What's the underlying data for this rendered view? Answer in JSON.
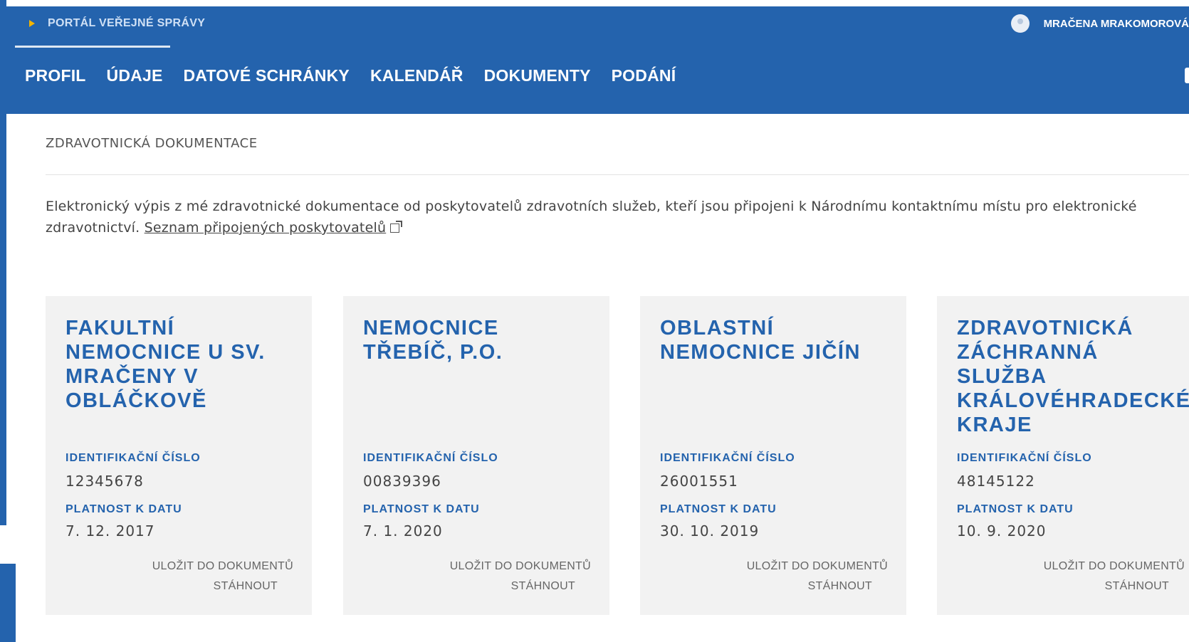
{
  "header": {
    "portal_label": "PORTÁL VEŘEJNÉ SPRÁVY",
    "user_name": "MRAČENA MRAKOMOROVÁ",
    "nav": [
      "PROFIL",
      "ÚDAJE",
      "DATOVÉ SCHRÁNKY",
      "KALENDÁŘ",
      "DOKUMENTY",
      "PODÁNÍ"
    ]
  },
  "page": {
    "breadcrumb": "ZDRAVOTNICKÁ DOKUMENTACE",
    "intro_text": "Elektronický výpis z mé zdravotnické dokumentace od poskytovatelů zdravotních služeb, kteří jsou připojeni k Národnímu kontaktnímu místu pro elektronické zdravotnictví.",
    "intro_link": "Seznam připojených poskytovatelů"
  },
  "cards": [
    {
      "title": "FAKULTNÍ NEMOCNICE U SV. MRAČENY V OBLÁČKOVĚ",
      "id_label": "IDENTIFIKAČNÍ ČÍSLO",
      "id_value": "12345678",
      "date_label": "PLATNOST K DATU",
      "date_value": "7. 12. 2017",
      "save_label": "ULOŽIT DO DOKUMENTŮ",
      "download_label": "STÁHNOUT"
    },
    {
      "title": "NEMOCNICE TŘEBÍČ, P.O.",
      "id_label": "IDENTIFIKAČNÍ ČÍSLO",
      "id_value": "00839396",
      "date_label": "PLATNOST K DATU",
      "date_value": "7. 1. 2020",
      "save_label": "ULOŽIT DO DOKUMENTŮ",
      "download_label": "STÁHNOUT"
    },
    {
      "title": "OBLASTNÍ NEMOCNICE JIČÍN",
      "id_label": "IDENTIFIKAČNÍ ČÍSLO",
      "id_value": "26001551",
      "date_label": "PLATNOST K DATU",
      "date_value": "30. 10. 2019",
      "save_label": "ULOŽIT DO DOKUMENTŮ",
      "download_label": "STÁHNOUT"
    },
    {
      "title": "ZDRAVOTNICKÁ ZÁCHRANNÁ SLUŽBA KRÁLOVÉHRADECKÉHO KRAJE",
      "id_label": "IDENTIFIKAČNÍ ČÍSLO",
      "id_value": "48145122",
      "date_label": "PLATNOST K DATU",
      "date_value": "10. 9. 2020",
      "save_label": "ULOŽIT DO DOKUMENTŮ",
      "download_label": "STÁHNOUT"
    }
  ]
}
